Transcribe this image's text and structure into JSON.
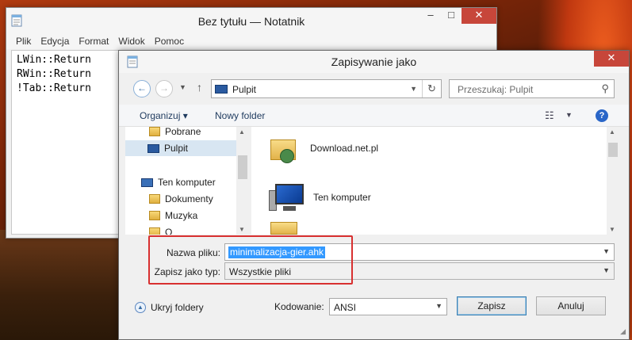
{
  "notepad": {
    "title": "Bez tytułu — Notatnik",
    "menu": [
      "Plik",
      "Edycja",
      "Format",
      "Widok",
      "Pomoc"
    ],
    "lines": [
      "LWin::Return",
      "RWin::Return",
      "!Tab::Return"
    ]
  },
  "dialog": {
    "title": "Zapisywanie jako",
    "address": "Pulpit",
    "search_placeholder": "Przeszukaj: Pulpit",
    "toolbar": {
      "organize": "Organizuj ▾",
      "new_folder": "Nowy folder"
    },
    "nav_items": [
      {
        "label": "Pobrane",
        "icon": "folder-download-icon",
        "selected": false
      },
      {
        "label": "Pulpit",
        "icon": "desktop-icon",
        "selected": true
      },
      {
        "label": "Ten komputer",
        "icon": "computer-icon",
        "selected": false
      },
      {
        "label": "Dokumenty",
        "icon": "documents-folder-icon",
        "selected": false
      },
      {
        "label": "Muzyka",
        "icon": "music-folder-icon",
        "selected": false
      },
      {
        "label": "O",
        "icon": "folder-icon",
        "selected": false
      }
    ],
    "files": [
      {
        "name": "Download.net.pl",
        "icon": "user-folder-icon"
      },
      {
        "name": "Ten komputer",
        "icon": "computer-icon"
      }
    ],
    "filename_label": "Nazwa pliku:",
    "filename_value": "minimalizacja-gier.ahk",
    "filetype_label": "Zapisz jako typ:",
    "filetype_value": "Wszystkie pliki",
    "hide_folders": "Ukryj foldery",
    "encoding_label": "Kodowanie:",
    "encoding_value": "ANSI",
    "save_button": "Zapisz",
    "cancel_button": "Anuluj"
  },
  "colors": {
    "highlight": "#3399ff",
    "annotation_box": "#d83030",
    "close_button": "#c7463a"
  }
}
